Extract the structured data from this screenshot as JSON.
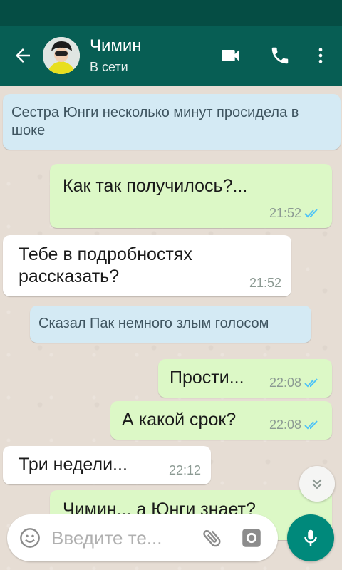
{
  "header": {
    "contact_name": "Чимин",
    "contact_status": "В сети",
    "icons": [
      "back-arrow-icon",
      "video-call-icon",
      "phone-icon",
      "more-vert-icon"
    ]
  },
  "messages": [
    {
      "kind": "system",
      "text": "Сестра Юнги несколько минут просидела в шоке"
    },
    {
      "kind": "outgoing",
      "text": "Как так получилось?...",
      "time": "21:52",
      "status": "read"
    },
    {
      "kind": "incoming",
      "text": "Тебе в подробностях рассказать?",
      "time": "21:52"
    },
    {
      "kind": "system",
      "text": "Сказал Пак немного злым голосом"
    },
    {
      "kind": "outgoing",
      "text": "Прости...",
      "time": "22:08",
      "status": "read"
    },
    {
      "kind": "outgoing",
      "text": "А какой срок?",
      "time": "22:08",
      "status": "read"
    },
    {
      "kind": "incoming",
      "text": "Три недели...",
      "time": "22:12"
    },
    {
      "kind": "outgoing",
      "text": "Чимин... а Юнги знает?",
      "time": "",
      "status": "partial"
    }
  ],
  "composer": {
    "placeholder": "Введите те...",
    "icons": [
      "emoji-icon",
      "attach-icon",
      "camera-icon",
      "mic-icon"
    ]
  },
  "colors": {
    "header": "#075e54",
    "status_bar": "#054d44",
    "outgoing_bubble": "#dcf8c6",
    "incoming_bubble": "#ffffff",
    "system_bubble": "#d4eaf4",
    "read_ticks": "#4fc3f7",
    "fab": "#00897b"
  }
}
